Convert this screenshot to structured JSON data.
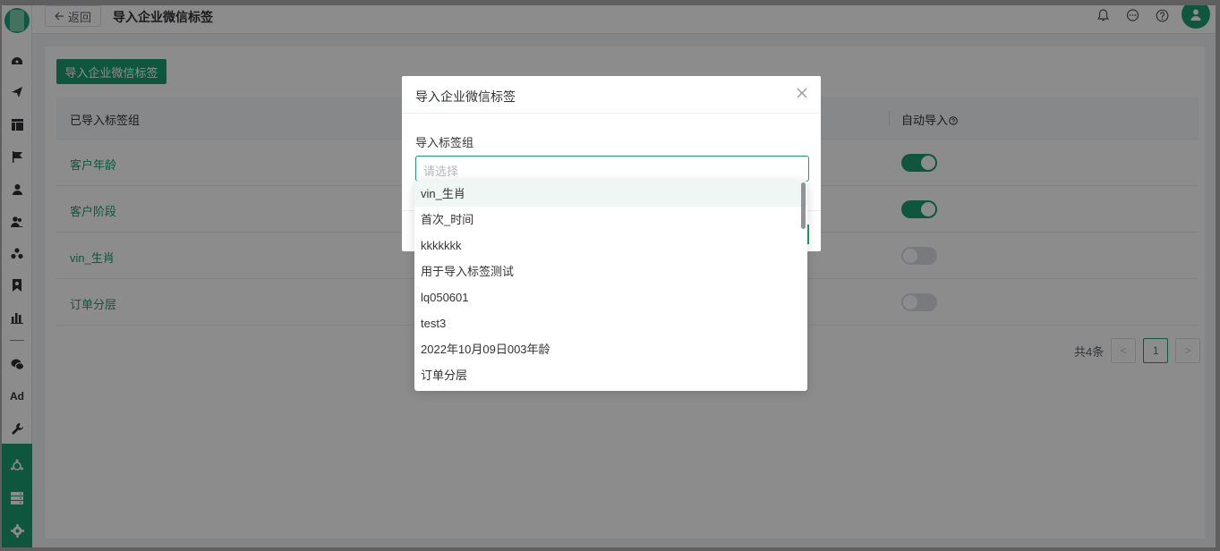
{
  "header": {
    "back_label": "返回",
    "title": "导入企业微信标签"
  },
  "sidebar": {
    "icons": [
      "dashboard-icon",
      "send-icon",
      "layout-icon",
      "flag-icon",
      "user-icon",
      "users-icon",
      "group-icon",
      "bookmark-icon",
      "bar-chart-icon",
      "wechat-icon",
      "ad-icon",
      "wrench-icon",
      "hub-icon",
      "server-icon",
      "gear-icon"
    ],
    "ad_label": "Ad"
  },
  "main": {
    "import_button": "导入企业微信标签",
    "table": {
      "col_group": "已导入标签组",
      "col_auto": "自动导入",
      "rows": [
        {
          "name": "客户年龄",
          "auto": true
        },
        {
          "name": "客户阶段",
          "auto": true
        },
        {
          "name": "vin_生肖",
          "auto": false
        },
        {
          "name": "订单分层",
          "auto": false
        }
      ]
    },
    "pagination": {
      "total": "共4条",
      "current": "1",
      "prev": "<",
      "next": ">"
    }
  },
  "dialog": {
    "title": "导入企业微信标签",
    "field_label": "导入标签组",
    "placeholder": "请选择",
    "options": [
      "vin_生肖",
      "首次_时间",
      "kkkkkkk",
      "用于导入标签测试",
      "lq050601",
      "test3",
      "2022年10月09日003年龄",
      "订单分层"
    ],
    "hovered_option": "vin_生肖"
  },
  "colors": {
    "accent": "#1a9e72",
    "link": "#1a9e72",
    "switch_off": "#dcdfe6"
  }
}
